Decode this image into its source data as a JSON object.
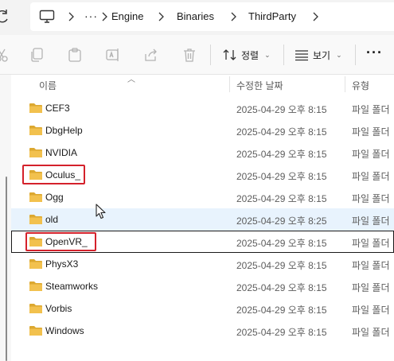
{
  "address_bar": {
    "overflow_label": "···",
    "crumbs": [
      "Engine",
      "Binaries",
      "ThirdParty"
    ]
  },
  "toolbar": {
    "sort_label": "정렬",
    "view_label": "보기",
    "more_label": "···"
  },
  "columns": {
    "name": "이름",
    "modified": "수정한 날짜",
    "type": "유형"
  },
  "files": [
    {
      "name": "CEF3",
      "modified": "2025-04-29 오후 8:15",
      "type": "파일 폴더"
    },
    {
      "name": "DbgHelp",
      "modified": "2025-04-29 오후 8:15",
      "type": "파일 폴더"
    },
    {
      "name": "NVIDIA",
      "modified": "2025-04-29 오후 8:15",
      "type": "파일 폴더"
    },
    {
      "name": "Oculus_",
      "modified": "2025-04-29 오후 8:15",
      "type": "파일 폴더",
      "highlighted": true
    },
    {
      "name": "Ogg",
      "modified": "2025-04-29 오후 8:15",
      "type": "파일 폴더"
    },
    {
      "name": "old",
      "modified": "2025-04-29 오후 8:25",
      "type": "파일 폴더",
      "hovered": true
    },
    {
      "name": "OpenVR_",
      "modified": "2025-04-29 오후 8:15",
      "type": "파일 폴더",
      "highlighted": true,
      "focused": true
    },
    {
      "name": "PhysX3",
      "modified": "2025-04-29 오후 8:15",
      "type": "파일 폴더"
    },
    {
      "name": "Steamworks",
      "modified": "2025-04-29 오후 8:15",
      "type": "파일 폴더"
    },
    {
      "name": "Vorbis",
      "modified": "2025-04-29 오후 8:15",
      "type": "파일 폴더"
    },
    {
      "name": "Windows",
      "modified": "2025-04-29 오후 8:15",
      "type": "파일 폴더"
    }
  ],
  "colors": {
    "folder": "#f2c14e",
    "folder_dark": "#dca830",
    "highlight_box": "#d4212b",
    "hover_row": "#e8f3fd"
  },
  "icons": {
    "refresh": "refresh-icon",
    "this_pc": "monitor-icon",
    "cut": "cut-icon",
    "copy": "copy-icon",
    "paste": "paste-icon",
    "rename": "rename-icon",
    "share": "share-icon",
    "delete": "trash-icon",
    "sort": "sort-icon",
    "view": "view-icon",
    "folder": "folder-icon"
  }
}
